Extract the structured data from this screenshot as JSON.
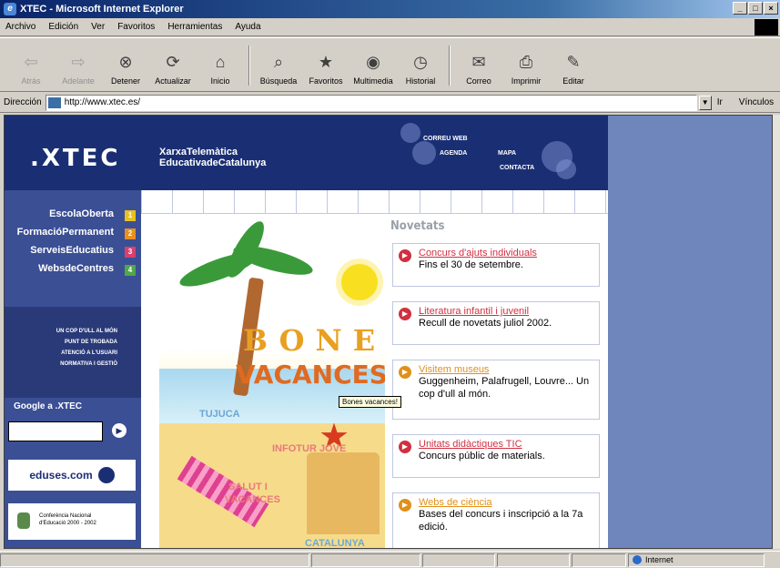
{
  "window": {
    "title": "XTEC - Microsoft Internet Explorer",
    "controls": [
      "_",
      "□",
      "×"
    ]
  },
  "menu": [
    "Archivo",
    "Edición",
    "Ver",
    "Favoritos",
    "Herramientas",
    "Ayuda"
  ],
  "toolbar": [
    {
      "label": "Atrás",
      "icon": "back-arrow-icon",
      "enabled": false
    },
    {
      "label": "Adelante",
      "icon": "forward-arrow-icon",
      "enabled": false
    },
    {
      "label": "Detener",
      "icon": "stop-icon",
      "enabled": true
    },
    {
      "label": "Actualizar",
      "icon": "refresh-icon",
      "enabled": true
    },
    {
      "label": "Inicio",
      "icon": "home-icon",
      "enabled": true
    },
    {
      "label": "Búsqueda",
      "icon": "search-icon",
      "enabled": true
    },
    {
      "label": "Favoritos",
      "icon": "favorites-icon",
      "enabled": true
    },
    {
      "label": "Multimedia",
      "icon": "multimedia-icon",
      "enabled": true
    },
    {
      "label": "Historial",
      "icon": "history-icon",
      "enabled": true
    },
    {
      "label": "Correo",
      "icon": "mail-icon",
      "enabled": true
    },
    {
      "label": "Imprimir",
      "icon": "print-icon",
      "enabled": true
    },
    {
      "label": "Editar",
      "icon": "edit-icon",
      "enabled": true
    }
  ],
  "address": {
    "label": "Dirección",
    "url": "http://www.xtec.es/",
    "go": "Ir",
    "links": "Vínculos"
  },
  "site": {
    "logo": ".XTEC",
    "logo_sub1": "XarxaTelemàtica",
    "logo_sub2": "EducativadeCatalunya",
    "header_links": [
      "CORREU WEB",
      "AGENDA",
      "MAPA",
      "CONTACTA"
    ],
    "nav": [
      {
        "label": "EscolaOberta",
        "num": "1",
        "color": "#e8c020"
      },
      {
        "label": "FormacióPermanent",
        "num": "2",
        "color": "#e89020"
      },
      {
        "label": "ServeisEducatius",
        "num": "3",
        "color": "#d84070"
      },
      {
        "label": "WebsdeCentres",
        "num": "4",
        "color": "#50a848"
      }
    ],
    "sublinks": [
      "UN COP D'ULL AL MÓN",
      "PUNT DE TROBADA",
      "ATENCIÓ A L'USUARI",
      "NORMATIVA I GESTIÓ"
    ],
    "google": "Google a .XTEC",
    "eduses": "eduses.com",
    "conf": [
      "Conferència Nacional",
      "d'Educació 2000 - 2002"
    ],
    "banner": {
      "bones": "BONES",
      "vacances": "VACANCES!",
      "labels": [
        "TUJUCA",
        "INFOTUR JOVE",
        "SALUT I",
        "VACANCES",
        "CATALUNYA"
      ],
      "tooltip": "Bones vacances!"
    },
    "news_heading": "Novetats",
    "news": [
      {
        "title": "Concurs d'ajuts individuals",
        "desc": "Fins el 30 de setembre.",
        "color": "#d03040"
      },
      {
        "title": "Literatura infantil i juvenil",
        "desc": "Recull de novetats juliol 2002.",
        "color": "#d03040"
      },
      {
        "title": "Visitem museus",
        "desc": "Guggenheim, Palafrugell, Louvre... Un cop d'ull al món.",
        "color": "#e0901a"
      },
      {
        "title": "Unitats didàctiques TIC",
        "desc": "Concurs públic de materials.",
        "color": "#d03040"
      },
      {
        "title": "Webs de ciència",
        "desc": "Bases del concurs i inscripció a la 7a edició.",
        "color": "#e0901a"
      }
    ]
  },
  "status": {
    "zone": "Internet"
  }
}
